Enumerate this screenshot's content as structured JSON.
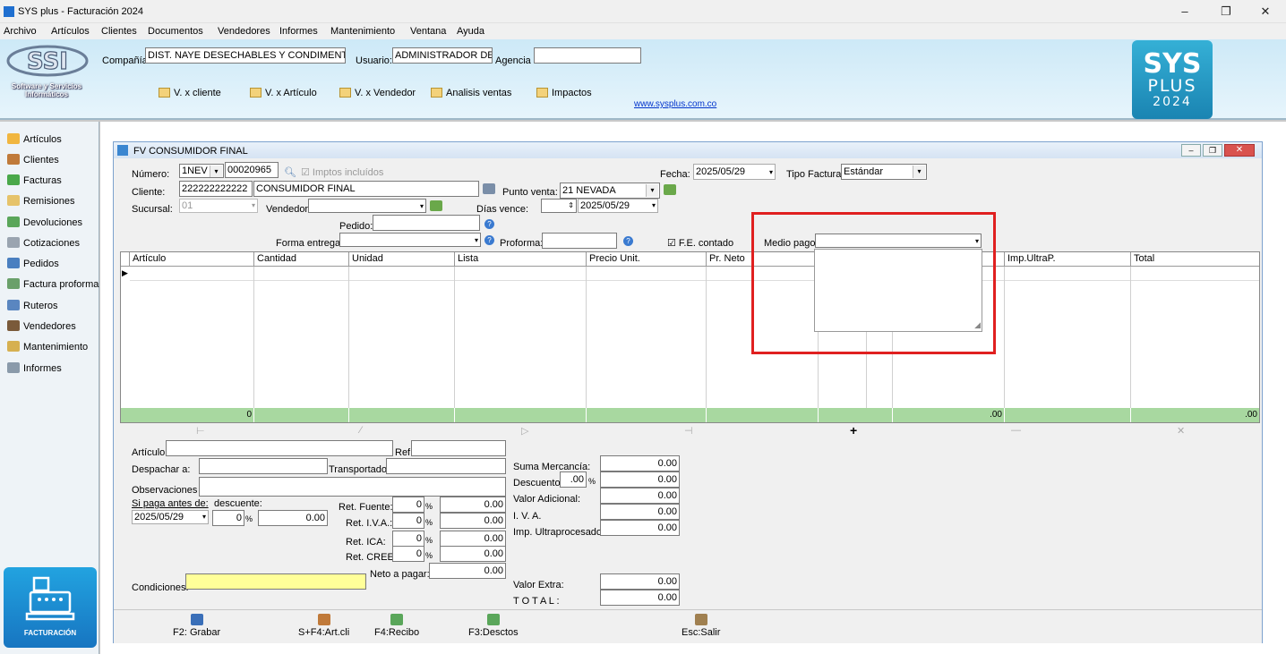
{
  "window": {
    "title": "SYS plus - Facturación 2024"
  },
  "menu": [
    "Archivo",
    "Artículos",
    "Clientes",
    "Documentos",
    "Vendedores",
    "Informes",
    "Mantenimiento",
    "Ventana",
    "Ayuda"
  ],
  "header": {
    "logo_sub": "Software y Servicios Informáticos",
    "company_label": "Compañía:",
    "company_value": "DIST. NAYE DESECHABLES Y CONDIMENTOS",
    "user_label": "Usuario:",
    "user_value": "ADMINISTRADOR DEL",
    "agency_label": "Agencia",
    "agency_value": "",
    "quick_buttons": [
      "V. x cliente",
      "V. x Artículo",
      "V. x Vendedor",
      "Analisis ventas",
      "Impactos"
    ],
    "website": "www.sysplus.com.co",
    "badge_line1": "SYS",
    "badge_line2": "PLUS",
    "badge_line3": "2024"
  },
  "sidebar": {
    "items": [
      "Artículos",
      "Clientes",
      "Facturas",
      "Remisiones",
      "Devoluciones",
      "Cotizaciones",
      "Pedidos",
      "Factura proforma",
      "Ruteros",
      "Vendedores",
      "Mantenimiento",
      "Informes"
    ],
    "badge_label": "FACTURACIÓN"
  },
  "invoice": {
    "title": "FV  CONSUMIDOR FINAL",
    "numero_label": "Número:",
    "prefix": "1NEV",
    "number": "00020965",
    "imptos_label": "Imptos incluídos",
    "fecha_label": "Fecha:",
    "fecha": "2025/05/29",
    "tipo_label": "Tipo Factura:",
    "tipo": "Estándar",
    "cliente_label": "Cliente:",
    "cliente_id": "222222222222",
    "cliente_name": "CONSUMIDOR FINAL",
    "punto_label": "Punto venta:",
    "punto": "21 NEVADA",
    "sucursal_label": "Sucursal:",
    "sucursal": "01",
    "vendedor_label": "Vendedor:",
    "dias_label": "Días vence:",
    "vence": "2025/05/29",
    "pedido_label": "Pedido:",
    "entrega_label": "Forma entrega:",
    "proforma_label": "Proforma:",
    "fe_label": "F.E. contado",
    "medio_label": "Medio pago:"
  },
  "grid": {
    "columns": [
      "Artículo",
      "Cantidad",
      "Unidad",
      "Lista",
      "Precio Unit.",
      "Pr. Neto",
      "",
      "",
      "",
      "Imp.UltraP.",
      "Total"
    ],
    "footer": [
      "",
      "0",
      "",
      "",
      "",
      "",
      "",
      "",
      ".00",
      "",
      ".00"
    ]
  },
  "bottom": {
    "articulo_label": "Artículo:",
    "ref_label": "Ref:",
    "despachar_label": "Despachar a:",
    "transportador_label": "Transportador:",
    "obs_label": "Observaciones :",
    "sipaga_label": "Si paga antes de:",
    "descuente_label": "descuente:",
    "sipaga_date": "2025/05/29",
    "desc_pct": "0",
    "desc_val": "0.00",
    "ret_fuente_label": "Ret. Fuente:",
    "ret_iva_label": "Ret. I.V.A.:",
    "ret_ica_label": "Ret. ICA:",
    "ret_cree_label": "Ret. CREE:",
    "ret_pct": "0",
    "ret_val": "0.00",
    "neto_label": "Neto a pagar:",
    "neto_val": "0.00",
    "condiciones_label": "Condiciones:",
    "suma_label": "Suma Mercancía:",
    "descuento_label": "Descuento:",
    "descuento_pct": ".00",
    "valor_adic_label": "Valor Adicional:",
    "iva_label": "I. V. A.",
    "ultra_label": "Imp. Ultraprocesados:",
    "valor_extra_label": "Valor Extra:",
    "total_label": "T O T A L :",
    "zero": "0.00"
  },
  "toolbar": [
    "F2: Grabar",
    "S+F4:Art.cli",
    "F4:Recibo",
    "F3:Desctos",
    "Esc:Salir"
  ]
}
